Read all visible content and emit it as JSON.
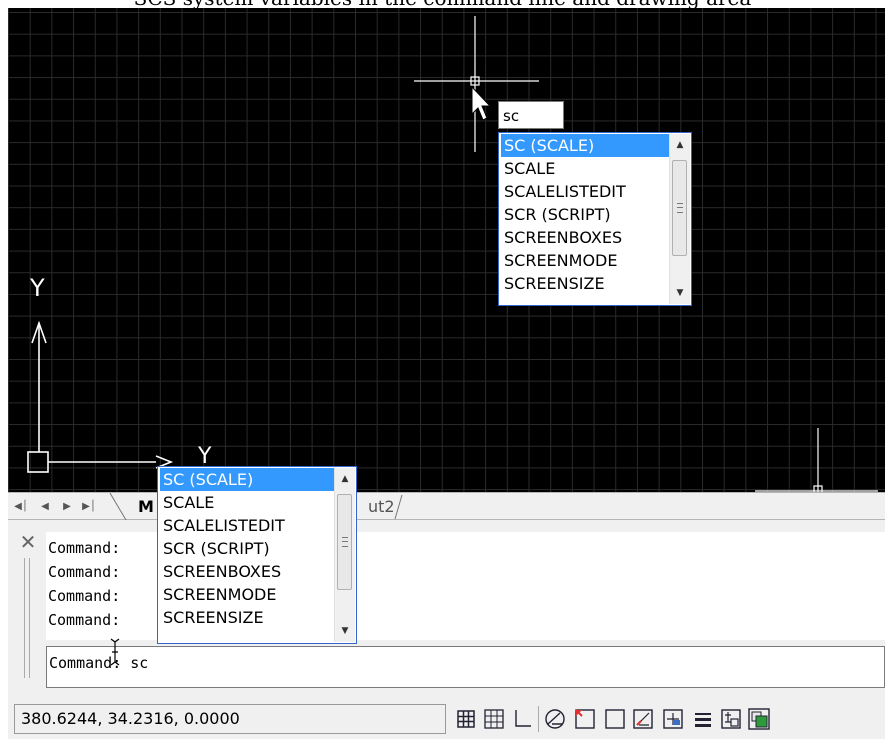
{
  "caption": "SCS system variables in the command line and drawing area",
  "dynamic_input": {
    "value": "sc"
  },
  "autocomplete": {
    "items": [
      "SC (SCALE)",
      "SCALE",
      "SCALELISTEDIT",
      "SCR (SCRIPT)",
      "SCREENBOXES",
      "SCREENMODE",
      "SCREENSIZE"
    ],
    "selected_index": 0
  },
  "ucs": {
    "upper_y_label": "Y",
    "lower_y_label": "Y"
  },
  "tabs": {
    "active": "M",
    "other": "ut2"
  },
  "command_history": [
    "Command:",
    "Command:",
    "Command:",
    "Command:"
  ],
  "command_input": "Command:  sc",
  "status": {
    "coordinates": "380.6244, 34.2316, 0.0000",
    "buttons": [
      "snap-mode-icon",
      "grid-display-icon",
      "ortho-mode-icon",
      "polar-tracking-icon",
      "object-snap-icon",
      "object-snap-tracking-icon",
      "dynamic-ucs-icon",
      "dynamic-input-icon",
      "lineweight-icon",
      "quick-properties-icon",
      "selection-cycling-icon"
    ]
  }
}
